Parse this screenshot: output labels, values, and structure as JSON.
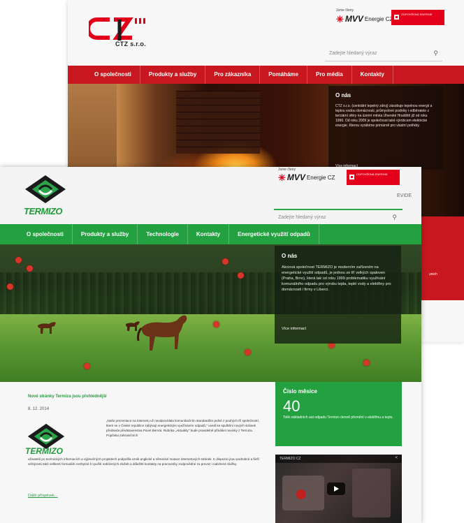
{
  "ctz": {
    "logo_text": "CTZ s.r.o.",
    "member_label": "Jsme členy",
    "mvv_label": "MVV",
    "energie_label": "Energie CZ",
    "badge_text": "ODPOVĚDNÁ ENERGIE",
    "search_placeholder": "Zadejte hledaný výraz",
    "nav": [
      "O společnosti",
      "Produkty a služby",
      "Pro zákazníka",
      "Pomáháme",
      "Pro média",
      "Kontakty"
    ],
    "info_title": "O nás",
    "info_text": "CTZ s.r.o. (centrální tepelný zdroj) zásobuje tepelnou energií a teplou vodou domácnosti, průmyslové podniky i odběratele z terciární sféry na území města Uherské Hradiště již od roku 1996. Od roku 2009 je společnost také výrobcem elektrické energie. Kterou vyrábíme primárně pro vlastní potřeby.",
    "info_more": "Více informací",
    "lower_text": "unich"
  },
  "termizo": {
    "logo_text": "TERMIZO",
    "member_label": "Jsme členy",
    "mvv_label": "MVV",
    "energie_label": "Energie CZ",
    "badge_text": "ODPOVĚDNÁ ENERGIE",
    "evide_label": "EVIDE",
    "search_placeholder": "Zadejte hledaný výraz",
    "nav": [
      "O společnosti",
      "Produkty a služby",
      "Technologie",
      "Kontakty",
      "Energetické využití odpadů"
    ],
    "info_title": "O nás",
    "info_text": "Akciová společnost TERMIZO je moderním zařízením na energetické využití odpadů, je jednou ze tří velkých spaloven (Praha, Brno), která tak od roku 1999 problematiku využívání komunálního odpadu pro výrobu tepla, teplé vody a elektřiny pro domácnosti i firmy v Liberci.",
    "info_more": "Více informací",
    "news": {
      "title": "Nové stránky Termiza jsou přehlednější",
      "date": "8. 12. 2014",
      "text1": "„Naše prezentace na internetu už neodpovídala komunikačním standardům jedné z pouhých tří společností, které se v České republice zabývají energetickým využíváním odpadů,\" uvedl ke spuštění nových stránek předseda představenstva Pavel Bernát. Rubrika „Aktuality\" bude pravidelně přinášet novinky z Termiza. Popůvka zahraničních",
      "text2": "uživatelů po technických informacích a výjimečných projektech podpořila vznik anglické a německé mutace internetových stránek. K dispozici jsou podrobné a širší veřejnosti také veškeré formuláře nezbytné k využití nabízených služeb a důležité kontakty na pracovníky zodpovědné za provoz i nabízené služby.",
      "more": "Další příspěvek..."
    },
    "month": {
      "title": "Číslo měsíce",
      "number": "40",
      "text": "Tolik nákladních aut odpadu Termizo denně přemění v elektřinu a teplo."
    },
    "video_title": "TERMIZO CZ"
  },
  "colors": {
    "ctz_red": "#c8171e",
    "termizo_green": "#23a03f",
    "mvv_red": "#e2001a"
  },
  "icons": {
    "search": "search-icon",
    "play": "play-icon",
    "share": "share-icon"
  }
}
